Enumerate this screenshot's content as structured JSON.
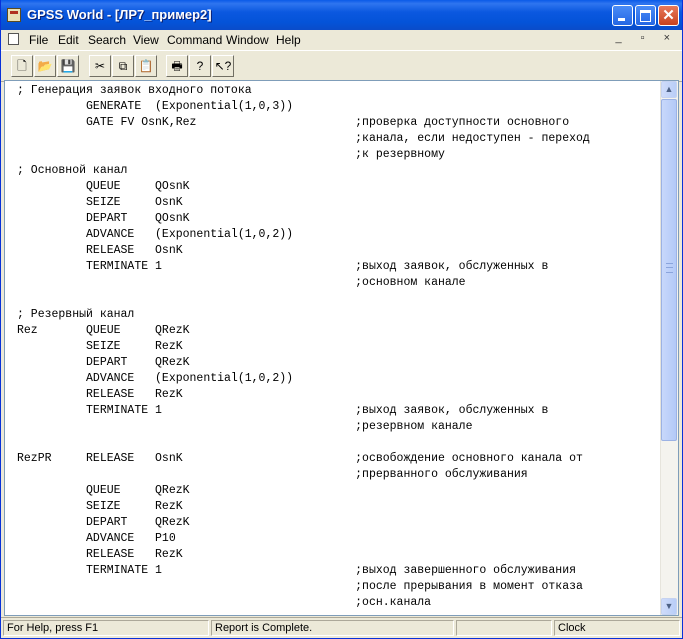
{
  "window": {
    "title": "GPSS World - [ЛР7_пример2]",
    "controls": {
      "minimize": "_",
      "maximize": "□",
      "close": "✕"
    },
    "icon": "gpss-app-icon"
  },
  "menu": {
    "items": [
      "File",
      "Edit",
      "Search",
      "View",
      "Command",
      "Window",
      "Help"
    ],
    "mdi_controls": "_ ▫ ×"
  },
  "toolbar": {
    "buttons": [
      {
        "name": "new-file-icon",
        "glyph": "🗋"
      },
      {
        "name": "open-folder-icon",
        "glyph": "📂"
      },
      {
        "name": "save-disk-icon",
        "glyph": "💾"
      },
      {
        "name": "cut-scissors-icon",
        "glyph": "✂"
      },
      {
        "name": "copy-icon",
        "glyph": "⧉"
      },
      {
        "name": "paste-clipboard-icon",
        "glyph": "📋"
      },
      {
        "name": "print-icon",
        "glyph": "🖶"
      },
      {
        "name": "help-question-icon",
        "glyph": "?"
      },
      {
        "name": "context-help-icon",
        "glyph": "↖?"
      }
    ]
  },
  "editor": {
    "lines": [
      "; Генерация заявок входного потока",
      "          GENERATE  (Exponential(1,0,3))",
      "          GATE FV OsnK,Rez                       ;проверка доступности основного",
      "                                                 ;канала, если недоступен - переход",
      "                                                 ;к резервному",
      "; Основной канал",
      "          QUEUE     QOsnK",
      "          SEIZE     OsnK",
      "          DEPART    QOsnK",
      "          ADVANCE   (Exponential(1,0,2))",
      "          RELEASE   OsnK",
      "          TERMINATE 1                            ;выход заявок, обслуженных в",
      "                                                 ;основном канале",
      "",
      "; Резервный канал",
      "Rez       QUEUE     QRezK",
      "          SEIZE     RezK",
      "          DEPART    QRezK",
      "          ADVANCE   (Exponential(1,0,2))",
      "          RELEASE   RezK",
      "          TERMINATE 1                            ;выход заявок, обслуженных в",
      "                                                 ;резервном канале",
      "",
      "RezPR     RELEASE   OsnK                         ;освобождение основного канала от",
      "                                                 ;прерванного обслуживания",
      "          QUEUE     QRezK",
      "          SEIZE     RezK",
      "          DEPART    QRezK",
      "          ADVANCE   P10",
      "          RELEASE   RezK",
      "          TERMINATE 1                            ;выход завершенного обслуживания",
      "                                                 ;после прерывания в момент отказа",
      "                                                 ;осн.канала"
    ]
  },
  "scrollbar": {
    "up": "▲",
    "down": "▼"
  },
  "status": {
    "help": "For Help, press F1",
    "report": "Report is Complete.",
    "blank": "",
    "clock": "Clock"
  }
}
